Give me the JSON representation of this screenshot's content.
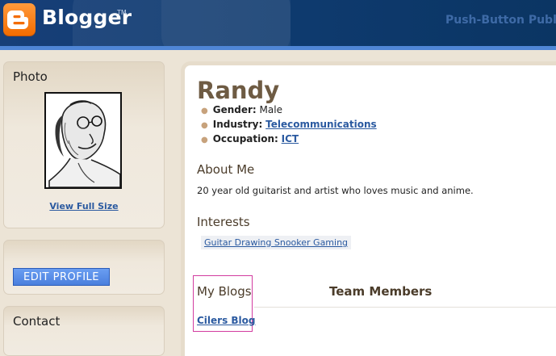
{
  "header": {
    "logo_text": "Blogger",
    "logo_tm": "TM",
    "tagline": "Push-Button Publish",
    "brand_color": "#f36c00",
    "header_color": "#0d3b6e"
  },
  "sidebar": {
    "photo": {
      "title": "Photo",
      "view_full_label": "View Full Size"
    },
    "edit_profile_label": "EDIT PROFILE",
    "contact_title": "Contact"
  },
  "profile": {
    "name": "Randy",
    "fields": [
      {
        "label": "Gender:",
        "value": "Male",
        "is_link": false
      },
      {
        "label": "Industry:",
        "value": "Telecommunications",
        "is_link": true
      },
      {
        "label": "Occupation:",
        "value": "ICT",
        "is_link": true
      }
    ],
    "about_title": "About Me",
    "about_text": "20 year old guitarist and artist who loves music and anime.",
    "interests_title": "Interests",
    "interests_text": "Guitar Drawing Snooker Gaming",
    "my_blogs_title": "My Blogs",
    "team_members_title": "Team Members",
    "blogs": [
      "Cilers Blog"
    ],
    "link_color": "#2b5aa0"
  }
}
